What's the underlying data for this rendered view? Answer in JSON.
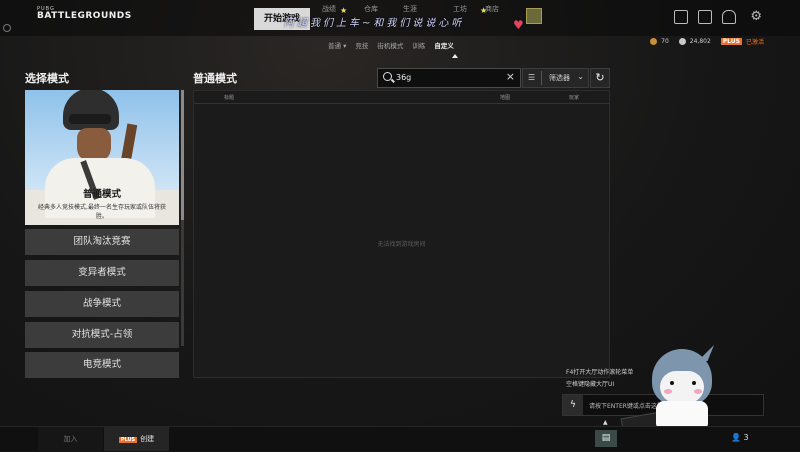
{
  "header": {
    "logo_small": "PUBG",
    "logo_big": "BATTLEGROUNDS",
    "start_game": "开始游戏",
    "nav_items": [
      "战绩",
      "仓库",
      "生涯",
      "工坊",
      "商店"
    ],
    "overlay_text": "阿超我们上车~和我们说说心听"
  },
  "currency": {
    "bp": "70",
    "gcoin": "24,802",
    "plus_badge": "PLUS",
    "plus_status": "已激活"
  },
  "subnav": {
    "items": [
      "普通",
      "竞技",
      "街机模式",
      "训练",
      "自定义"
    ],
    "active_index": 4
  },
  "left": {
    "title": "选择模式",
    "hero": {
      "name": "普通模式",
      "description": "经典多人竞技模式,最终一名生存玩家或队伍将获胜。"
    },
    "modes": [
      "团队淘汰竞赛",
      "变异者模式",
      "战争模式",
      "对抗模式-占领",
      "电竞模式"
    ]
  },
  "right": {
    "title": "普通模式",
    "search": {
      "value": "36g",
      "placeholder": ""
    },
    "filter_label": "筛选器",
    "columns": [
      "标题",
      "地图",
      "玩家"
    ],
    "empty_message": "无法找到游戏房间"
  },
  "chat": {
    "hint_line1": "F4打开大厅动作滚轮菜单",
    "hint_line2": "空格键隐藏大厅UI",
    "input_placeholder": "请按下ENTER键或点击这里使用聊天功能。"
  },
  "bottom": {
    "join": "加入",
    "create_badge": "PLUS",
    "create": "创建",
    "friends_count": "3"
  },
  "colors": {
    "accent_orange": "#e8732a",
    "heart": "#e0445e",
    "panel_button": "#3c3c3c"
  }
}
